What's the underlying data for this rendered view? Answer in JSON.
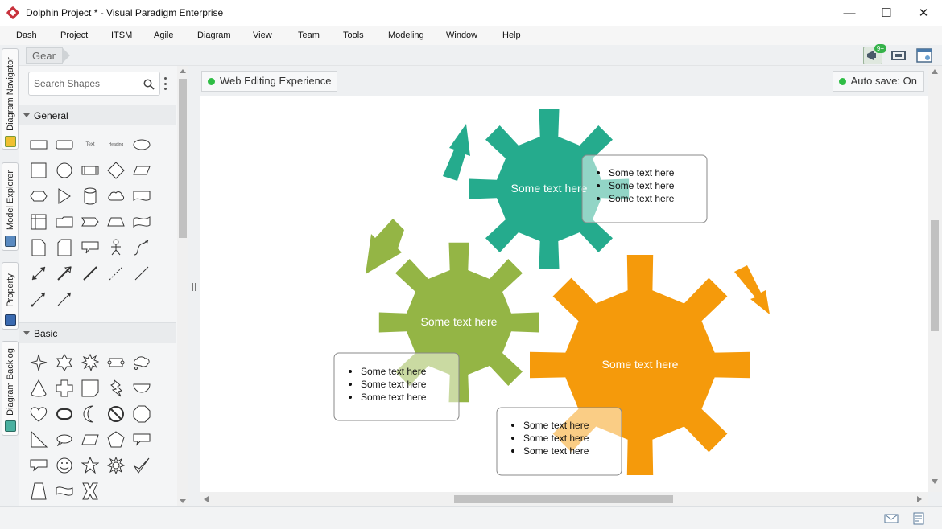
{
  "window": {
    "title": "Dolphin Project * - Visual Paradigm Enterprise",
    "minimize": "—",
    "maximize": "☐",
    "close": "✕"
  },
  "menu": [
    "Dash",
    "Project",
    "ITSM",
    "Agile",
    "Diagram",
    "View",
    "Team",
    "Tools",
    "Modeling",
    "Window",
    "Help"
  ],
  "breadcrumb": "Gear",
  "toolbar": {
    "badge": "9+"
  },
  "side_tabs": [
    "Diagram Navigator",
    "Model Explorer",
    "Property",
    "Diagram Backlog"
  ],
  "search": {
    "placeholder": "Search Shapes"
  },
  "sections": {
    "general": "General",
    "basic": "Basic"
  },
  "shape_labels": {
    "text": "Text",
    "heading": "Heading"
  },
  "diagram_tab": "Web Editing Experience",
  "autosave": "Auto save: On",
  "gears": [
    {
      "label": "Some text here",
      "color": "#25ab8d"
    },
    {
      "label": "Some text here",
      "color": "#94b545"
    },
    {
      "label": "Some text here",
      "color": "#f59a0b"
    }
  ],
  "callouts": [
    {
      "items": [
        "Some text here",
        "Some text here",
        "Some text here"
      ]
    },
    {
      "items": [
        "Some text here",
        "Some text here",
        "Some text here"
      ]
    },
    {
      "items": [
        "Some text here",
        "Some text here",
        "Some text here"
      ]
    }
  ]
}
